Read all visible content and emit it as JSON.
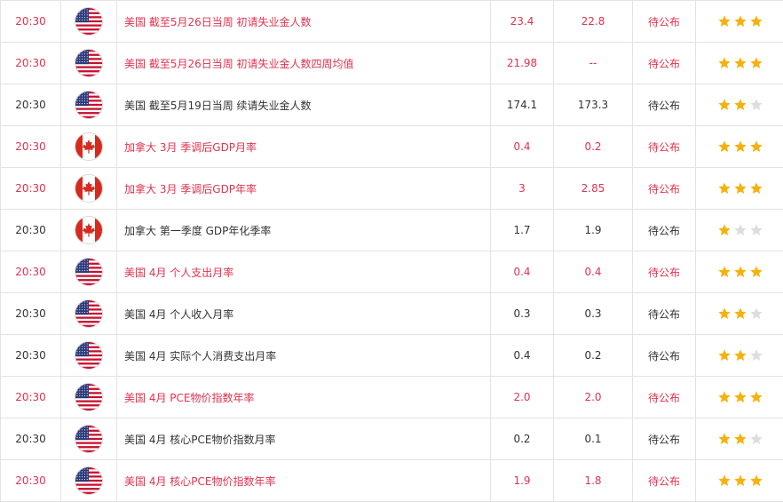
{
  "colors": {
    "highlight": "#e0334f",
    "normal": "#333333",
    "star_on": "#f6b10d",
    "star_off": "#dddddd"
  },
  "rows": [
    {
      "time": "20:30",
      "flag": "us-flag-icon",
      "event": "美国 截至5月26日当周 初请失业金人数",
      "previous": "23.4",
      "forecast": "22.8",
      "actual": "待公布",
      "stars": 3,
      "highlight": true
    },
    {
      "time": "20:30",
      "flag": "us-flag-icon",
      "event": "美国 截至5月26日当周 初请失业金人数四周均值",
      "previous": "21.98",
      "forecast": "--",
      "actual": "待公布",
      "stars": 3,
      "highlight": true
    },
    {
      "time": "20:30",
      "flag": "us-flag-icon",
      "event": "美国 截至5月19日当周 续请失业金人数",
      "previous": "174.1",
      "forecast": "173.3",
      "actual": "待公布",
      "stars": 2,
      "highlight": false
    },
    {
      "time": "20:30",
      "flag": "canada-flag-icon",
      "event": "加拿大 3月 季调后GDP月率",
      "previous": "0.4",
      "forecast": "0.2",
      "actual": "待公布",
      "stars": 3,
      "highlight": true
    },
    {
      "time": "20:30",
      "flag": "canada-flag-icon",
      "event": "加拿大 3月 季调后GDP年率",
      "previous": "3",
      "forecast": "2.85",
      "actual": "待公布",
      "stars": 3,
      "highlight": true
    },
    {
      "time": "20:30",
      "flag": "canada-flag-icon",
      "event": "加拿大 第一季度 GDP年化季率",
      "previous": "1.7",
      "forecast": "1.9",
      "actual": "待公布",
      "stars": 1,
      "highlight": false
    },
    {
      "time": "20:30",
      "flag": "us-flag-icon",
      "event": "美国 4月 个人支出月率",
      "previous": "0.4",
      "forecast": "0.4",
      "actual": "待公布",
      "stars": 3,
      "highlight": true
    },
    {
      "time": "20:30",
      "flag": "us-flag-icon",
      "event": "美国 4月 个人收入月率",
      "previous": "0.3",
      "forecast": "0.3",
      "actual": "待公布",
      "stars": 2,
      "highlight": false
    },
    {
      "time": "20:30",
      "flag": "us-flag-icon",
      "event": "美国 4月 实际个人消费支出月率",
      "previous": "0.4",
      "forecast": "0.2",
      "actual": "待公布",
      "stars": 2,
      "highlight": false
    },
    {
      "time": "20:30",
      "flag": "us-flag-icon",
      "event": "美国 4月 PCE物价指数年率",
      "previous": "2.0",
      "forecast": "2.0",
      "actual": "待公布",
      "stars": 3,
      "highlight": true
    },
    {
      "time": "20:30",
      "flag": "us-flag-icon",
      "event": "美国 4月 核心PCE物价指数月率",
      "previous": "0.2",
      "forecast": "0.1",
      "actual": "待公布",
      "stars": 2,
      "highlight": false
    },
    {
      "time": "20:30",
      "flag": "us-flag-icon",
      "event": "美国 4月 核心PCE物价指数年率",
      "previous": "1.9",
      "forecast": "1.8",
      "actual": "待公布",
      "stars": 3,
      "highlight": true
    }
  ]
}
